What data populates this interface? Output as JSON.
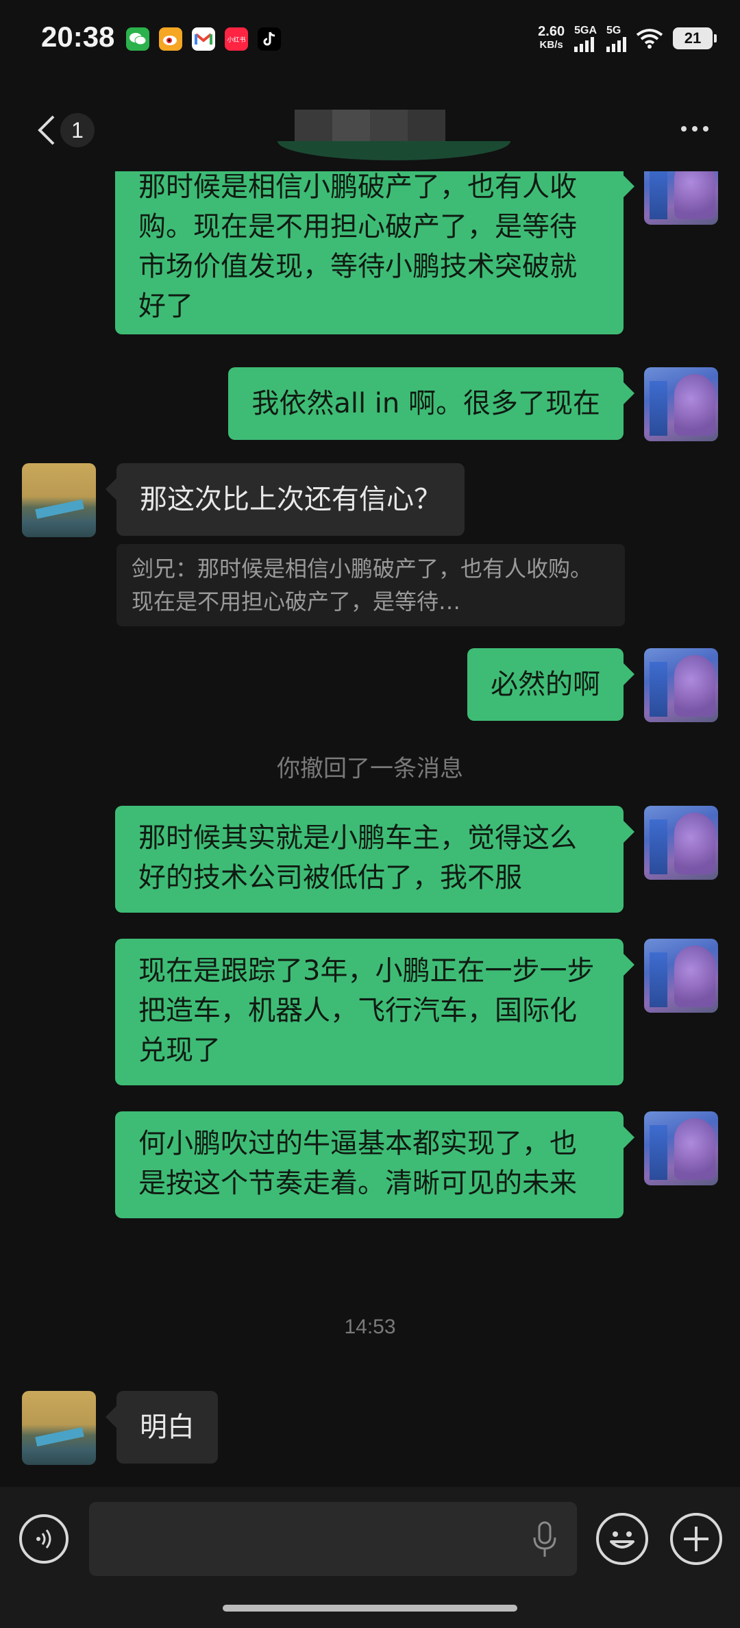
{
  "status_bar": {
    "time": "20:38",
    "apps": [
      "wechat-icon",
      "weibo-icon",
      "gmail-icon",
      "xiaohongshu-icon",
      "tiktok-icon"
    ],
    "xiaohongshu_label": "小红书",
    "speed_value": "2.60",
    "speed_unit": "KB/s",
    "signal1_label": "5GA",
    "signal2_label": "5G",
    "battery": "21"
  },
  "header": {
    "unread_count": "1"
  },
  "messages": [
    {
      "side": "me",
      "text": "那时候是相信小鹏破产了，也有人收购。现在是不用担心破产了，是等待市场价值发现，等待小鹏技术突破就好了"
    },
    {
      "side": "me",
      "text": "我依然all in 啊。很多了现在"
    },
    {
      "side": "other",
      "text": "那这次比上次还有信心？",
      "quote": "剑兄：那时候是相信小鹏破产了，也有人收购。现在是不用担心破产了，是等待…"
    },
    {
      "side": "me",
      "text": "必然的啊"
    },
    {
      "system": "你撤回了一条消息"
    },
    {
      "side": "me",
      "text": "那时候其实就是小鹏车主，觉得这么好的技术公司被低估了，我不服"
    },
    {
      "side": "me",
      "text": "现在是跟踪了3年，小鹏正在一步一步把造车，机器人，飞行汽车，国际化兑现了"
    },
    {
      "side": "me",
      "text": "何小鹏吹过的牛逼基本都实现了，也是按这个节奏走着。清晰可见的未来"
    },
    {
      "timestamp": "14:53"
    },
    {
      "side": "other",
      "text": "明白"
    }
  ],
  "input": {
    "value": "",
    "placeholder": ""
  },
  "colors": {
    "background": "#111111",
    "my_bubble": "#3ebc75",
    "other_bubble": "#2a2a2a",
    "input_bar": "#1a1a1a"
  }
}
